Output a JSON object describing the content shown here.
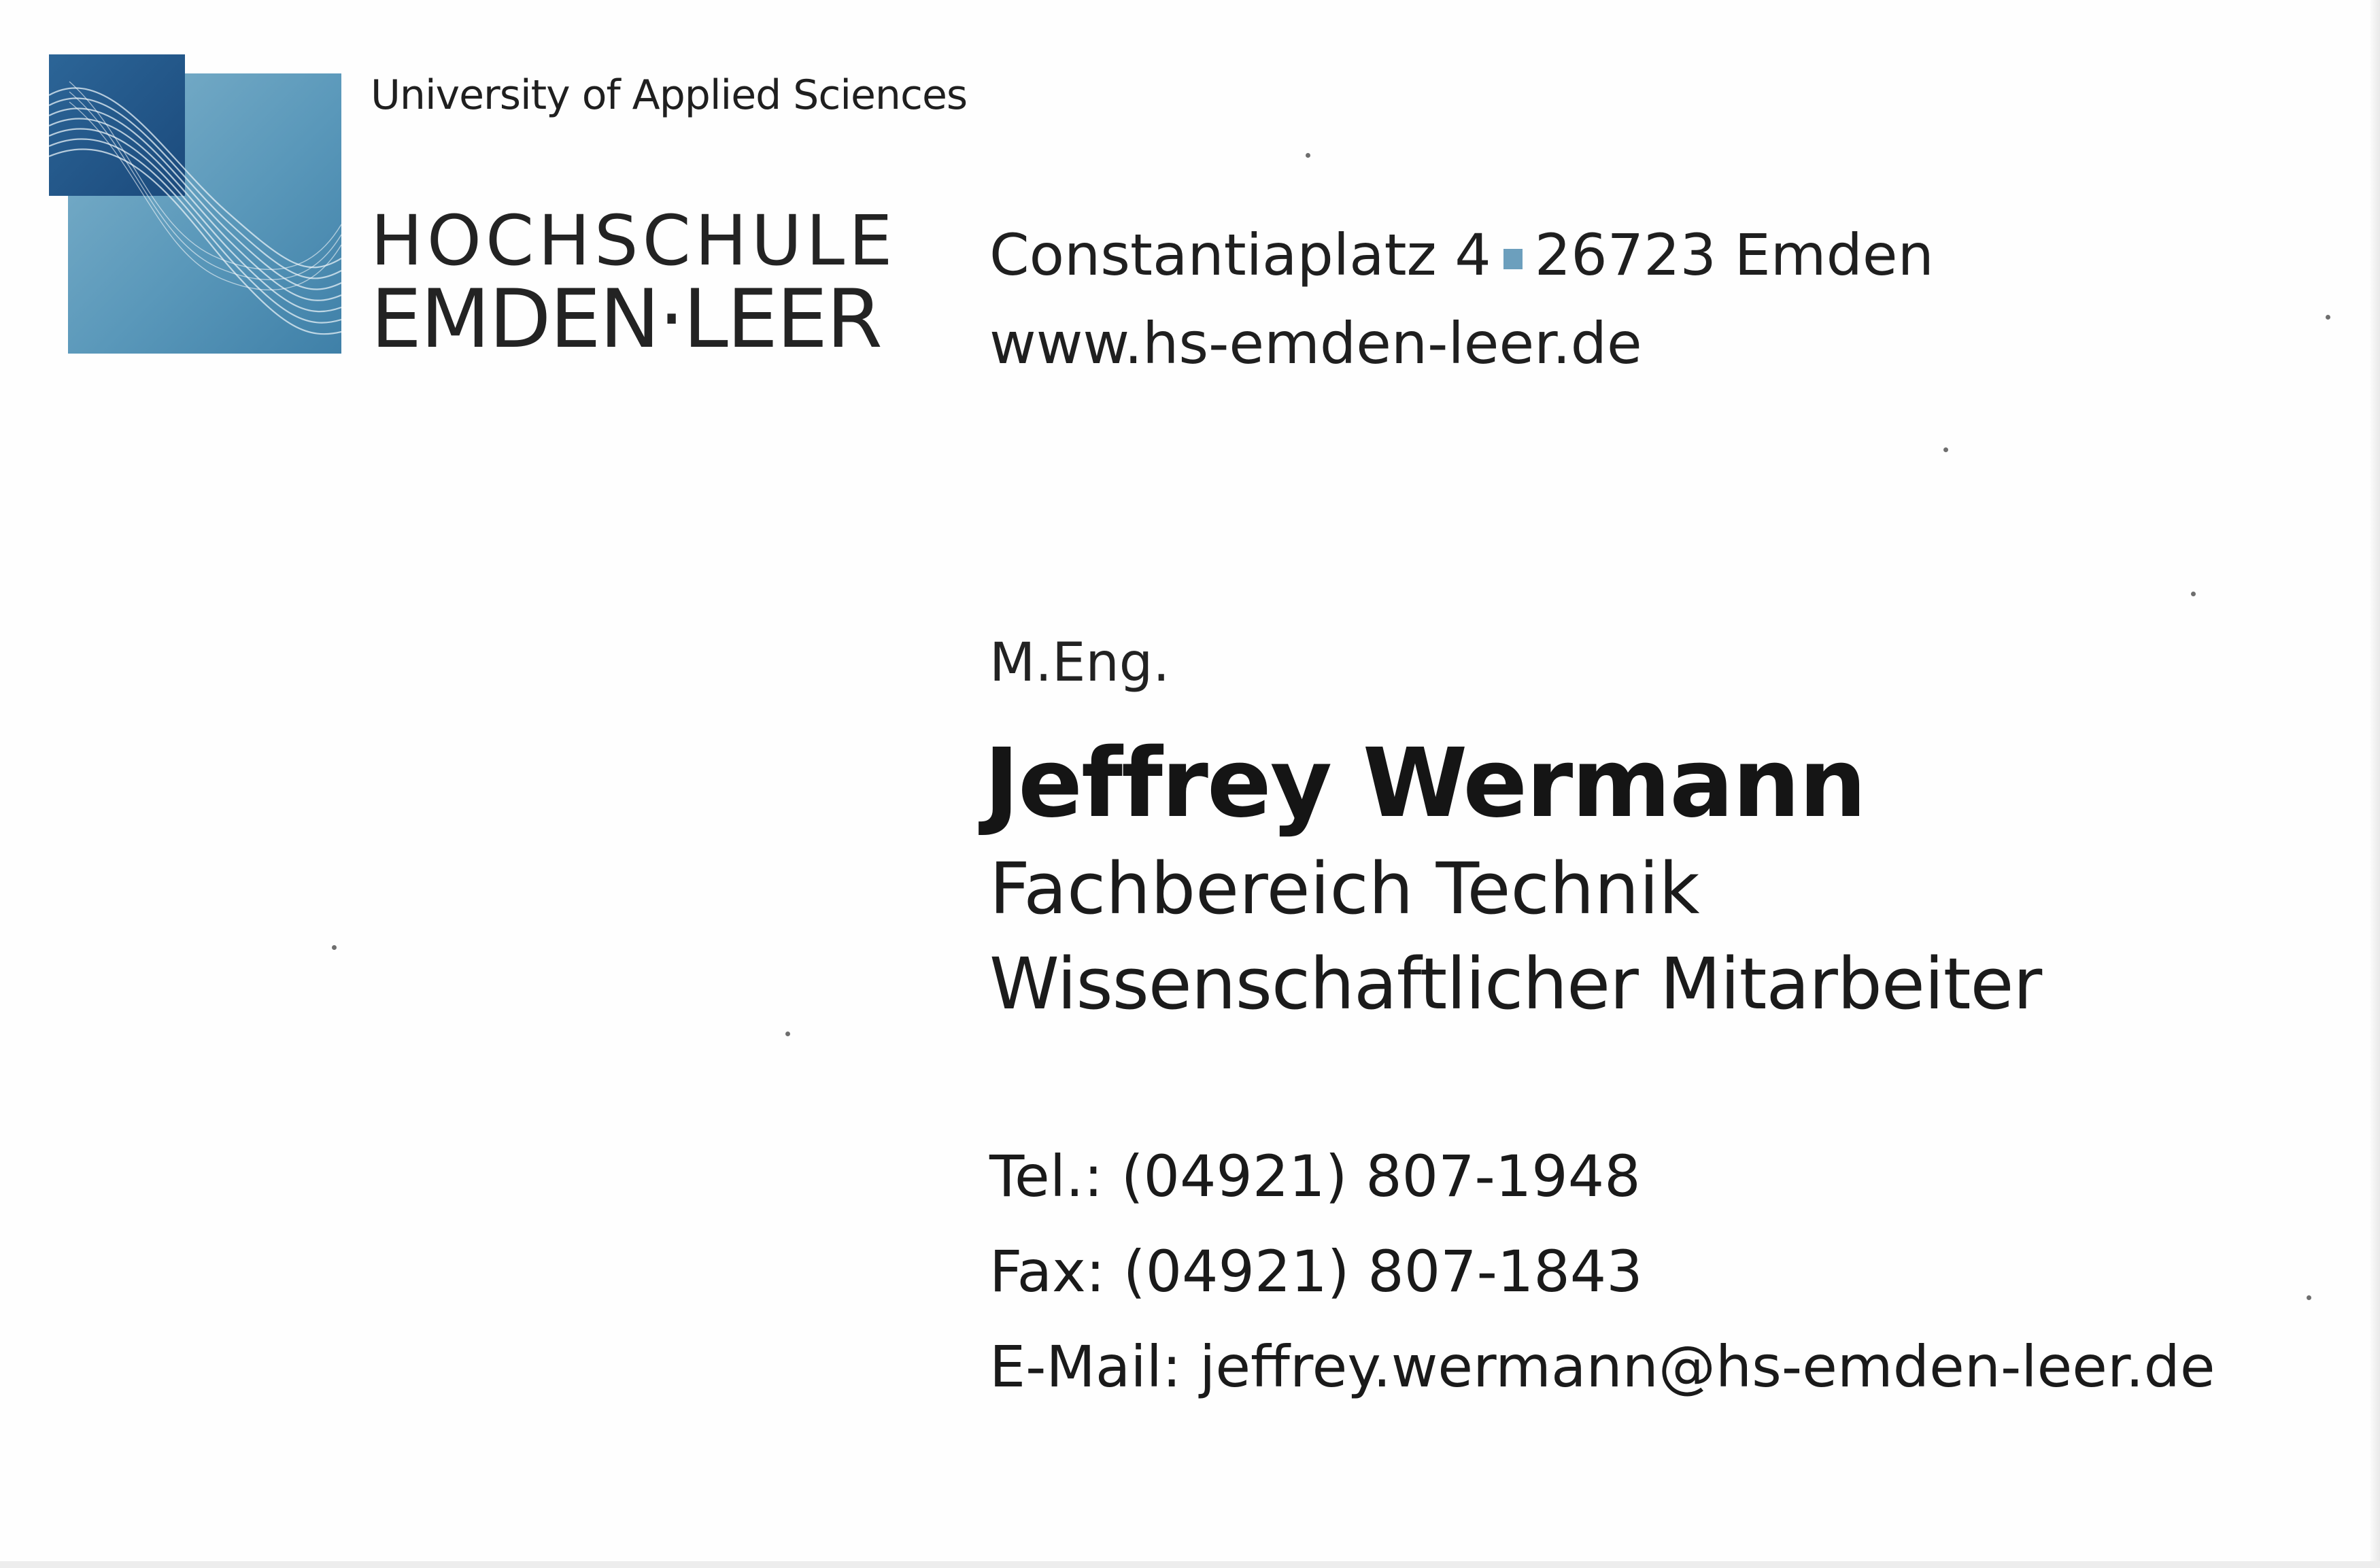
{
  "logo": {
    "tagline": "University of Applied Sciences",
    "name_line1": "HOCHSCHULE",
    "name_line2": "EMDEN·LEER",
    "colors": {
      "dark_blue": "#1f5487",
      "mid_blue": "#4f90b3",
      "light_blue": "#7fb2cb",
      "accent_square": "#6c9fbd"
    }
  },
  "address": {
    "street": "Constantiaplatz 4",
    "city": "26723 Emden",
    "website": "www.hs-emden-leer.de"
  },
  "person": {
    "degree": "M.Eng.",
    "name": "Jeffrey Wermann",
    "department": "Fachbereich Technik",
    "role": "Wissenschaftlicher Mitarbeiter"
  },
  "contact": {
    "tel": "Tel.: (04921) 807-1948",
    "fax": "Fax: (04921) 807-1843",
    "email": "E-Mail: jeffrey.wermann@hs-emden-leer.de"
  }
}
